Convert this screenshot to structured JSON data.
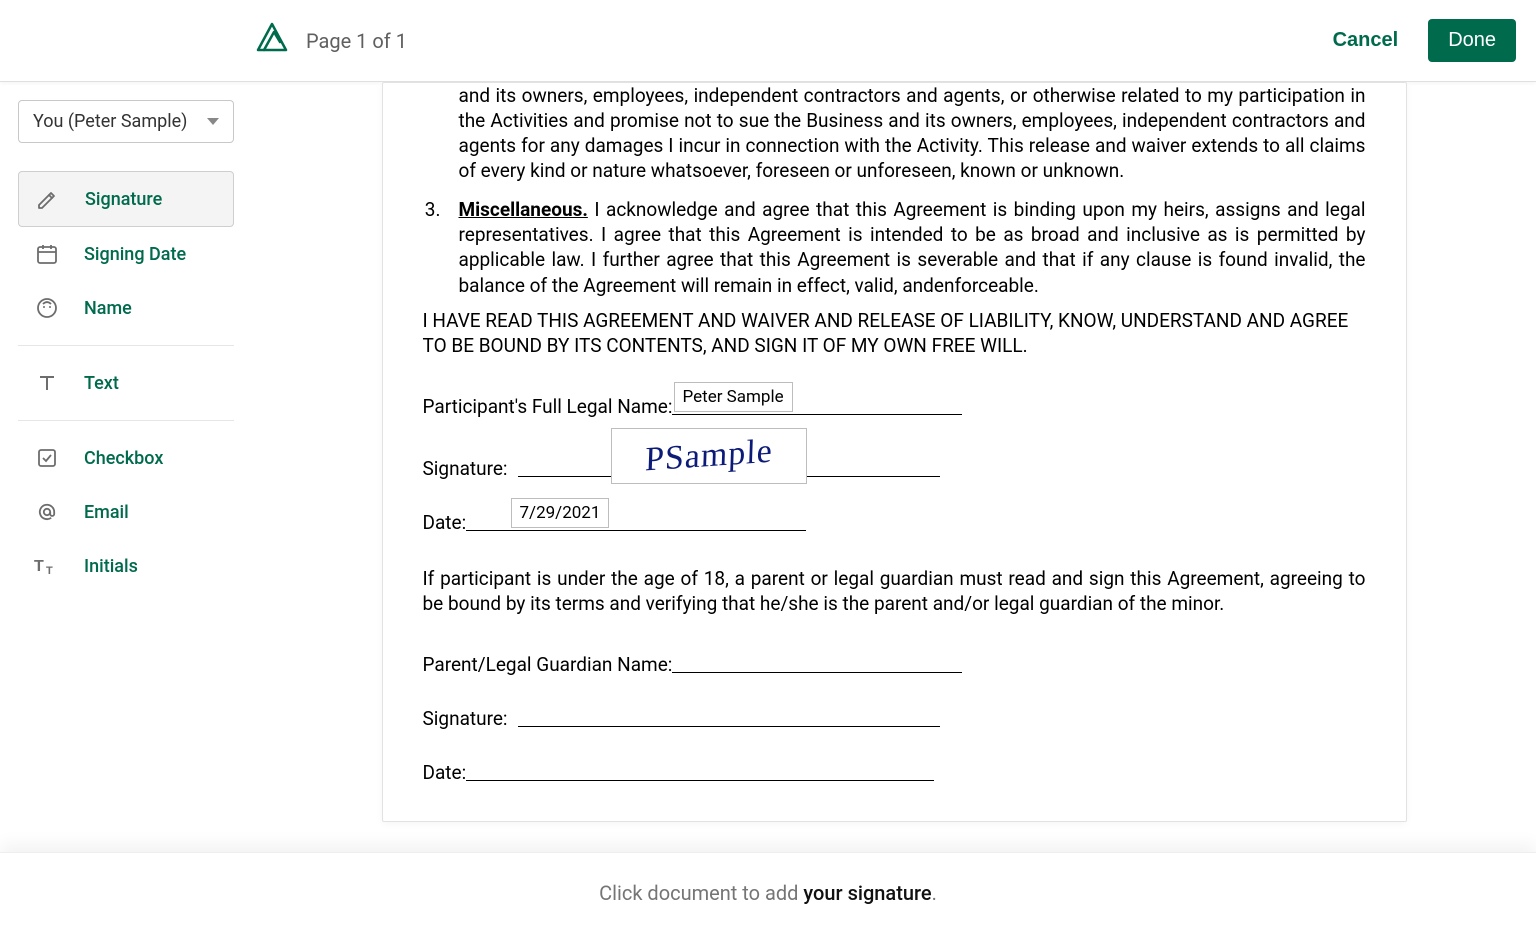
{
  "header": {
    "page_label": "Page 1 of 1",
    "cancel": "Cancel",
    "done": "Done"
  },
  "sidebar": {
    "recipient": "You (Peter Sample)",
    "tools": {
      "signature": "Signature",
      "signing_date": "Signing Date",
      "name": "Name",
      "text": "Text",
      "checkbox": "Checkbox",
      "email": "Email",
      "initials": "Initials"
    }
  },
  "document": {
    "release_partial": "and its owners, employees, independent contractors and agents, or otherwise related to my participation in the Activities and promise not to sue the Business and its owners, employees, independent contractors and agents for any damages I incur in connection with the Activity. This release and waiver extends to all claims of every kind or nature whatsoever, foreseen or unforeseen, known or unknown.",
    "misc_num": "3.",
    "misc_head": "Miscellaneous.",
    "misc_body": " I acknowledge and agree that this Agreement is binding upon my heirs, assigns and legal representatives. I agree that this Agreement is intended to be as broad and inclusive as is permitted by applicable law. I further agree that this Agreement is severable and that if any clause is found invalid, the balance of the Agreement will remain in effect, valid, andenforceable.",
    "ack": "I HAVE READ THIS AGREEMENT AND WAIVER AND RELEASE OF LIABILITY, KNOW, UNDERSTAND AND AGREE TO BE BOUND BY ITS CONTENTS, AND SIGN IT OF MY OWN FREE WILL.",
    "labels": {
      "full_name": "Participant's Full Legal Name:",
      "signature": "Signature:",
      "date": "Date:",
      "parent_name": "Parent/Legal Guardian Name:",
      "parent_sig": "Signature:",
      "parent_date": "Date:"
    },
    "values": {
      "full_name": "Peter Sample",
      "signature_display": "PSample",
      "date": "7/29/2021"
    },
    "under18": "If participant is under the age of 18, a parent or legal guardian must read and sign this Agreement, agreeing to be bound by its terms and verifying that he/she is the parent and/or legal guardian of the minor."
  },
  "footer": {
    "prefix": "Click document to add ",
    "em": "your signature",
    "suffix": "."
  }
}
